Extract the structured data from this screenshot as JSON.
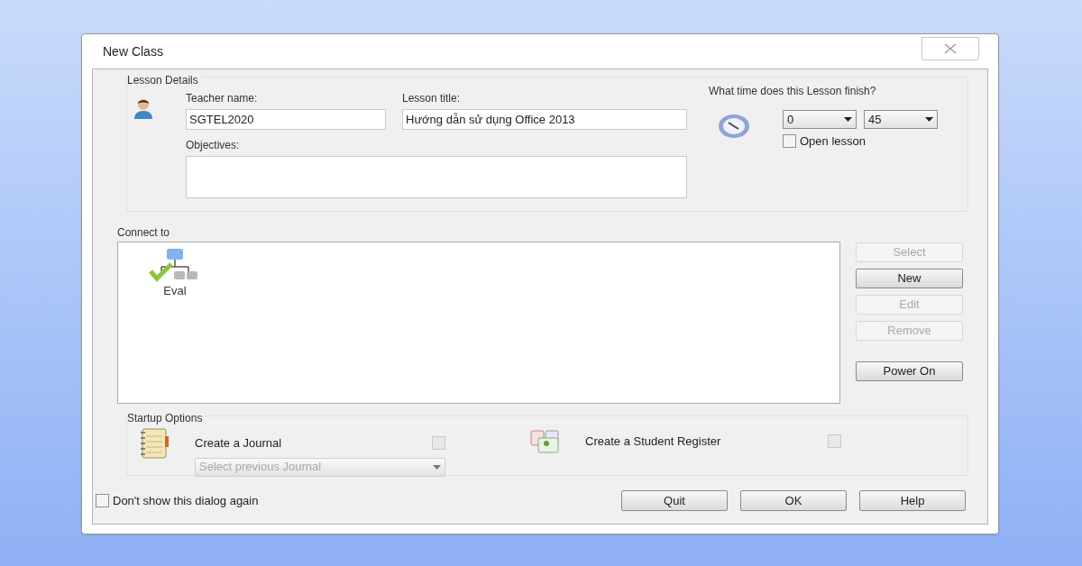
{
  "window": {
    "title": "New Class"
  },
  "lesson_details": {
    "title": "Lesson Details",
    "teacher_name": {
      "label": "Teacher name:",
      "value": "SGTEL2020"
    },
    "lesson_title": {
      "label": "Lesson title:",
      "value": "Hướng dẫn sử dụng Office 2013"
    },
    "objectives": {
      "label": "Objectives:"
    },
    "finish_time": {
      "question": "What time does this Lesson finish?",
      "hour": "0",
      "minute": "45"
    },
    "open_lesson": {
      "label": "Open lesson",
      "checked": false
    }
  },
  "connect_to": {
    "title": "Connect to",
    "items": [
      {
        "label": "Eval"
      }
    ]
  },
  "side_buttons": [
    {
      "label": "Select",
      "disabled": true
    },
    {
      "label": "New",
      "disabled": false
    },
    {
      "label": "Edit",
      "disabled": true
    },
    {
      "label": "Remove",
      "disabled": true
    },
    {
      "label": "Power On",
      "disabled": false
    }
  ],
  "startup_options": {
    "title": "Startup Options",
    "journal": {
      "label": "Create a Journal",
      "checked": false,
      "select": {
        "placeholder": "Select previous Journal",
        "disabled": true
      }
    },
    "register": {
      "label": "Create a Student Register",
      "checked": false
    }
  },
  "dont_show": {
    "label": "Don't show this dialog again",
    "checked": false
  },
  "buttons": [
    "Quit",
    "OK",
    "Help"
  ]
}
